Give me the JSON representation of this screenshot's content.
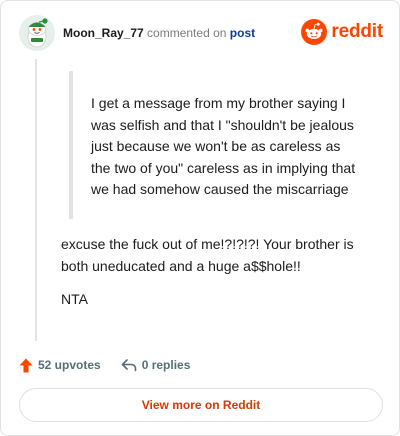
{
  "header": {
    "username": "Moon_Ray_77",
    "action_text": "commented on",
    "post_link": "post",
    "brand": "reddit",
    "avatar_icon": "snoo-avatar-icon",
    "logo_icon": "reddit-logo-icon"
  },
  "comment": {
    "quote": "I get a message from my brother saying I was selfish and that I \"shouldn't be jealous just because we won't be as careless as the two of you\" careless as in implying that we had somehow caused the miscarriage",
    "paragraphs": [
      "excuse the fuck out of me!?!?!?! Your brother is both uneducated and a huge a$$hole!!",
      "NTA"
    ]
  },
  "footer": {
    "upvotes": "52 upvotes",
    "replies": "0 replies",
    "upvote_icon": "upvote-arrow-icon",
    "reply_icon": "reply-arrow-icon"
  },
  "cta": {
    "label": "View more on Reddit"
  },
  "colors": {
    "brand": "#ff4500",
    "link": "#0a3d91",
    "cta_text": "#d93900",
    "muted": "#7c7c7c"
  }
}
